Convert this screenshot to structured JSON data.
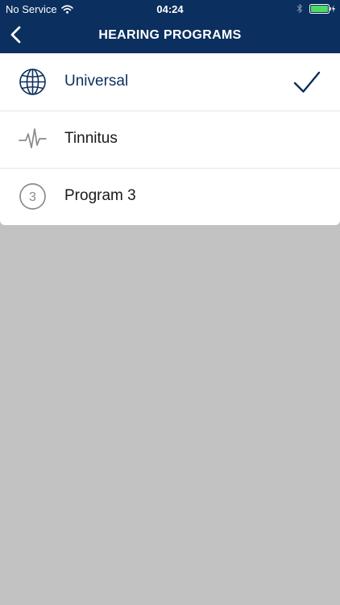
{
  "status_bar": {
    "carrier": "No Service",
    "time": "04:24",
    "icons": [
      "wifi-icon",
      "bluetooth-icon",
      "battery-icon",
      "charging-icon"
    ]
  },
  "nav": {
    "title": "HEARING PROGRAMS",
    "back_icon": "chevron-left-icon"
  },
  "programs": [
    {
      "label": "Universal",
      "icon": "globe-icon",
      "selected": true
    },
    {
      "label": "Tinnitus",
      "icon": "waveform-icon",
      "selected": false
    },
    {
      "label": "Program 3",
      "icon": "number-circle-icon",
      "badge": "3",
      "selected": false
    }
  ],
  "colors": {
    "header": "#0b2f5e",
    "background": "#c2c2c2",
    "battery": "#4cd964",
    "icon_gray": "#8a8a8a"
  }
}
